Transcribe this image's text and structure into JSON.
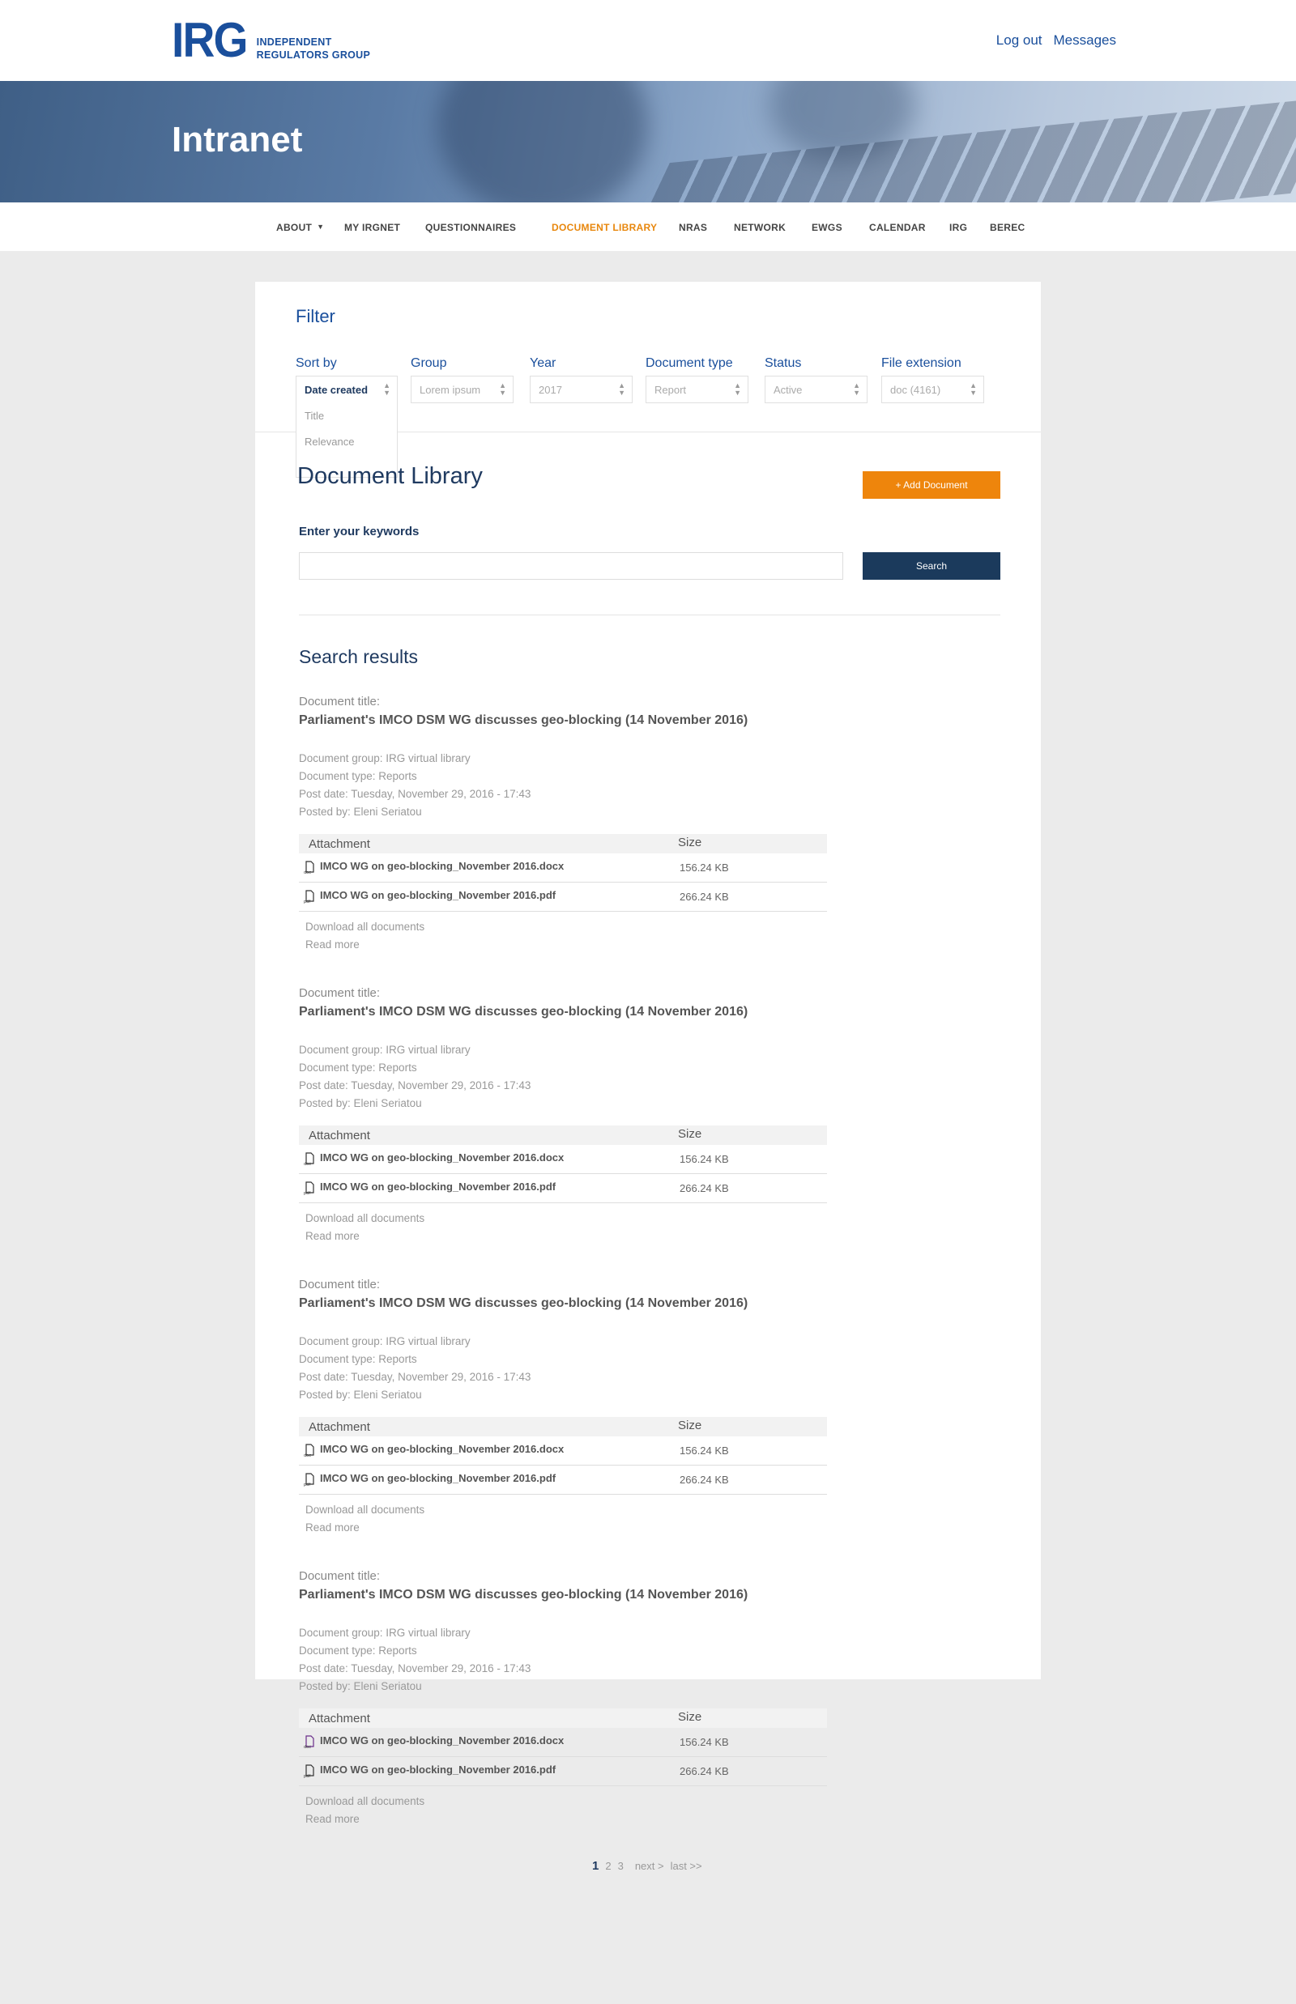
{
  "header": {
    "logo_mark": "IRG",
    "logo_line1": "INDEPENDENT",
    "logo_line2": "REGULATORS GROUP",
    "logout": "Log out",
    "messages": "Messages"
  },
  "hero": {
    "title": "Intranet"
  },
  "nav": {
    "items": [
      "ABOUT",
      "MY IRGNET",
      "QUESTIONNAIRES",
      "DOCUMENT LIBRARY",
      "NRAS",
      "NETWORK",
      "EWGS",
      "CALENDAR",
      "IRG",
      "BEREC"
    ],
    "active": "DOCUMENT LIBRARY"
  },
  "filter": {
    "title": "Filter",
    "sort_by": {
      "label": "Sort by",
      "value": "Date created",
      "options": [
        "Date created",
        "Title",
        "Relevance"
      ]
    },
    "group": {
      "label": "Group",
      "value": "Lorem ipsum"
    },
    "year": {
      "label": "Year",
      "value": "2017"
    },
    "doc_type": {
      "label": "Document type",
      "value": "Report"
    },
    "status": {
      "label": "Status",
      "value": "Active"
    },
    "file_ext": {
      "label": "File extension",
      "value": "doc (4161)"
    }
  },
  "library": {
    "title": "Document Library",
    "add_button": "+ Add Document",
    "keywords_label": "Enter your keywords",
    "search_button": "Search",
    "results_title": "Search results"
  },
  "results": [
    {
      "label": "Document title:",
      "title": "Parliament's IMCO DSM WG discusses geo-blocking (14 November 2016)",
      "group": "Document group: IRG virtual library",
      "type": "Document type: Reports",
      "date": "Post date: Tuesday, November 29, 2016 - 17:43",
      "posted_by": "Posted by: Eleni Seriatou",
      "att_header": "Attachment",
      "size_header": "Size",
      "files": [
        {
          "name": "IMCO WG on geo-blocking_November 2016.docx",
          "size": "156.24 KB",
          "ext": "docx"
        },
        {
          "name": "IMCO WG on geo-blocking_November 2016.pdf",
          "size": "266.24 KB",
          "ext": "pdf"
        }
      ],
      "download_all": "Download all documents",
      "read_more": "Read more"
    },
    {
      "label": "Document title:",
      "title": "Parliament's IMCO DSM WG discusses geo-blocking (14 November 2016)",
      "group": "Document group: IRG virtual library",
      "type": "Document type: Reports",
      "date": "Post date: Tuesday, November 29, 2016 - 17:43",
      "posted_by": "Posted by: Eleni Seriatou",
      "att_header": "Attachment",
      "size_header": "Size",
      "files": [
        {
          "name": "IMCO WG on geo-blocking_November 2016.docx",
          "size": "156.24 KB",
          "ext": "docx"
        },
        {
          "name": "IMCO WG on geo-blocking_November 2016.pdf",
          "size": "266.24 KB",
          "ext": "pdf"
        }
      ],
      "download_all": "Download all documents",
      "read_more": "Read more"
    },
    {
      "label": "Document title:",
      "title": "Parliament's IMCO DSM WG discusses geo-blocking (14 November 2016)",
      "group": "Document group: IRG virtual library",
      "type": "Document type: Reports",
      "date": "Post date: Tuesday, November 29, 2016 - 17:43",
      "posted_by": "Posted by: Eleni Seriatou",
      "att_header": "Attachment",
      "size_header": "Size",
      "files": [
        {
          "name": "IMCO WG on geo-blocking_November 2016.docx",
          "size": "156.24 KB",
          "ext": "docx"
        },
        {
          "name": "IMCO WG on geo-blocking_November 2016.pdf",
          "size": "266.24 KB",
          "ext": "pdf"
        }
      ],
      "download_all": "Download all documents",
      "read_more": "Read more"
    },
    {
      "label": "Document title:",
      "title": "Parliament's IMCO DSM WG discusses geo-blocking (14 November 2016)",
      "group": "Document group: IRG virtual library",
      "type": "Document type: Reports",
      "date": "Post date: Tuesday, November 29, 2016 - 17:43",
      "posted_by": "Posted by: Eleni Seriatou",
      "att_header": "Attachment",
      "size_header": "Size",
      "files": [
        {
          "name": "IMCO WG on geo-blocking_November 2016.docx",
          "size": "156.24 KB",
          "ext": "docx"
        },
        {
          "name": "IMCO WG on geo-blocking_November 2016.pdf",
          "size": "266.24 KB",
          "ext": "pdf"
        }
      ],
      "download_all": "Download all documents",
      "read_more": "Read more"
    }
  ],
  "pager": {
    "pages": [
      "1",
      "2",
      "3"
    ],
    "current": "1",
    "next": "next >",
    "last": "last >>"
  },
  "colors": {
    "brand_blue": "#1a4f9c",
    "accent_orange": "#ee850c",
    "search_navy": "#1b3a5c"
  }
}
